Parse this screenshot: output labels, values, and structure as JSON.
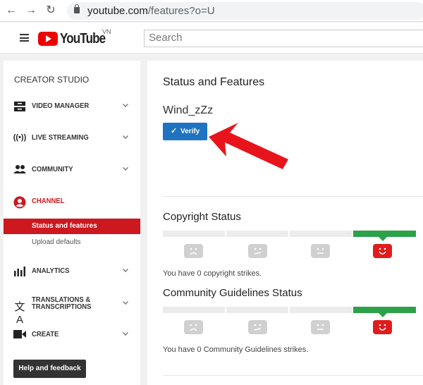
{
  "browser": {
    "url_host": "youtube.com",
    "url_path": "/features?o=U",
    "back_icon": "arrow-left-icon",
    "forward_icon": "arrow-right-icon",
    "reload_icon": "reload-icon",
    "lock_icon": "lock-icon"
  },
  "header": {
    "logo_text": "YouTube",
    "region": "VN",
    "search_placeholder": "Search"
  },
  "sidebar": {
    "title": "CREATOR STUDIO",
    "items": [
      {
        "label": "VIDEO MANAGER",
        "icon": "video-manager-icon",
        "expandable": true
      },
      {
        "label": "LIVE STREAMING",
        "icon": "live-streaming-icon",
        "expandable": true
      },
      {
        "label": "COMMUNITY",
        "icon": "community-icon",
        "expandable": true
      },
      {
        "label": "CHANNEL",
        "icon": "channel-icon",
        "expandable": false,
        "active": true
      },
      {
        "label": "ANALYTICS",
        "icon": "analytics-icon",
        "expandable": true
      },
      {
        "label": "TRANSLATIONS &",
        "label2": "TRANSCRIPTIONS",
        "icon": "translate-icon",
        "expandable": true
      },
      {
        "label": "CREATE",
        "icon": "create-video-icon",
        "expandable": true
      }
    ],
    "subitems": [
      {
        "label": "Status and features",
        "active": true
      },
      {
        "label": "Upload defaults",
        "active": false
      }
    ],
    "help_label": "Help and feedback",
    "active_color": "#cc181e"
  },
  "main": {
    "title": "Status and Features",
    "channel_name": "Wind_zZz",
    "verify_label": "Verify",
    "copyright": {
      "title": "Copyright Status",
      "text": "You have 0 copyright strikes.",
      "active_level": 4,
      "levels": 4
    },
    "community": {
      "title": "Community Guidelines Status",
      "text": "You have 0 Community Guidelines strikes.",
      "active_level": 4,
      "levels": 4
    },
    "colors": {
      "good": "#2ca14a",
      "face_active": "#e21b1b",
      "verify": "#1f73c0"
    }
  }
}
